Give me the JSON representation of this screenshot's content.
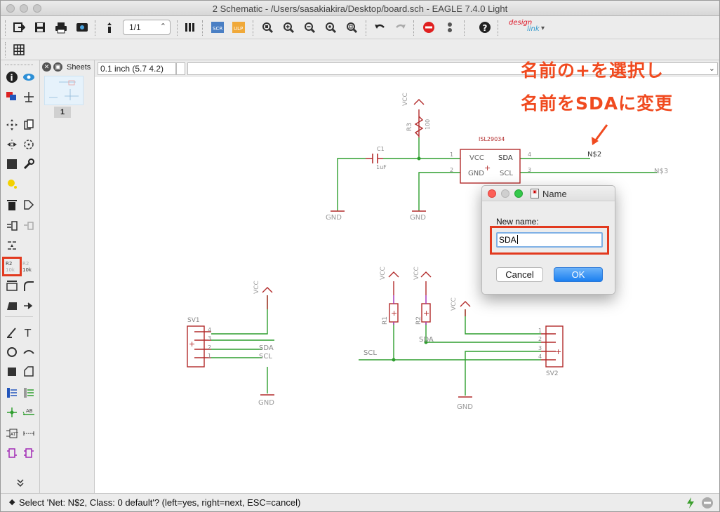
{
  "window": {
    "title": "2 Schematic - /Users/sasakiakira/Desktop/board.sch - EAGLE 7.4.0 Light"
  },
  "toolbar": {
    "sheet_select_value": "1/1",
    "design_link_top": "design",
    "design_link_bottom": "link"
  },
  "sheets_panel": {
    "label": "Sheets",
    "sheet_number": "1"
  },
  "coord_bar": {
    "grid_readout": "0.1 inch (5.7 4.2)",
    "command_value": ""
  },
  "annotation": {
    "line1": "名前の+を選択し",
    "line2": "名前をSDAに変更"
  },
  "schematic": {
    "ic_name": "ISL29034",
    "ic_pins": {
      "vcc": "VCC",
      "gnd": "GND",
      "sda": "SDA",
      "scl": "SCL"
    },
    "pin_numbers": {
      "p1": "1",
      "p2": "2",
      "p3": "3",
      "p4": "4"
    },
    "net_n2": "N$2",
    "net_n3": "N$3",
    "vcc": "VCC",
    "gnd": "GND",
    "r3_name": "R3",
    "r3_value": "100",
    "c1_name": "C1",
    "c1_value": "1uF",
    "r1_name": "R1",
    "r2_name": "R2",
    "sv1_name": "SV1",
    "sv2_name": "SV2",
    "sda_label": "SDA",
    "scl_label": "SCL",
    "sv1_pins": [
      "4",
      "3",
      "2",
      "1"
    ],
    "sv2_pins": [
      "1",
      "2",
      "3",
      "4"
    ]
  },
  "dialog": {
    "title": "Name",
    "new_name_label": "New name:",
    "new_name_value": "SDA",
    "cancel_label": "Cancel",
    "ok_label": "OK"
  },
  "status": {
    "message": "Select 'Net: N$2, Class: 0 default'? (left=yes, right=next, ESC=cancel)"
  },
  "colors": {
    "net_green": "#2e9e2e",
    "symbol_red": "#b22a2a",
    "annotation_orange": "#f04a1f",
    "highlight_red": "#e23a1f",
    "ok_blue": "#1b7ff0"
  }
}
